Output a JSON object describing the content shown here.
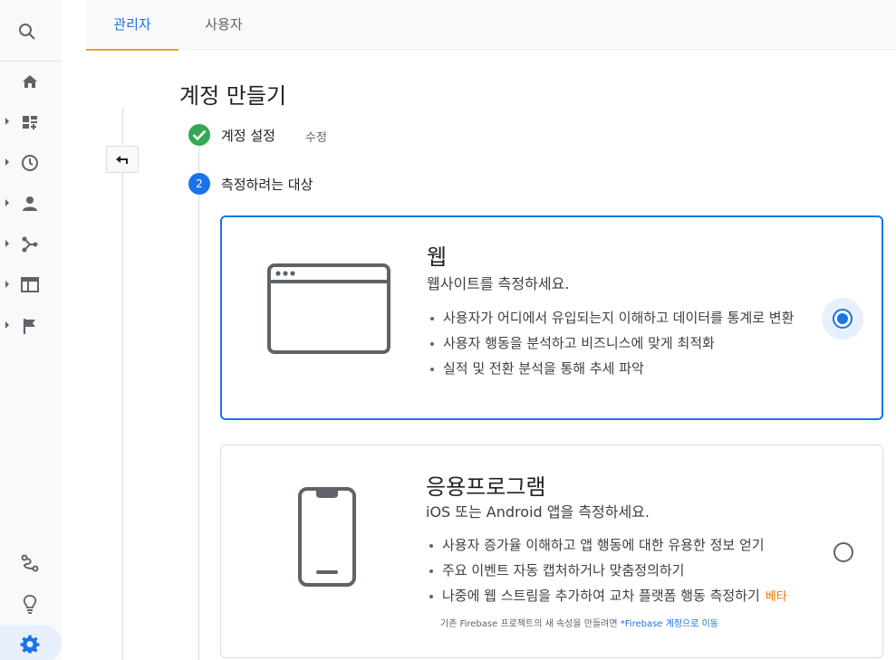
{
  "tabs": {
    "admin": "관리자",
    "user": "사용자"
  },
  "page": {
    "title": "계정 만들기"
  },
  "steps": {
    "step1": {
      "label": "계정 설정",
      "edit": "수정"
    },
    "step2": {
      "number": "2",
      "label": "측정하려는 대상"
    }
  },
  "options": {
    "web": {
      "title": "웹",
      "subtitle": "웹사이트를 측정하세요.",
      "bullets": [
        "사용자가 어디에서 유입되는지 이해하고 데이터를 통계로 변환",
        "사용자 행동을 분석하고 비즈니스에 맞게 최적화",
        "실적 및 전환 분석을 통해 추세 파악"
      ],
      "selected": true
    },
    "app": {
      "title": "응용프로그램",
      "subtitle": "iOS 또는 Android 앱을 측정하세요.",
      "bullets": [
        "사용자 증가율 이해하고 앱 행동에 대한 유용한 정보 얻기",
        "주요 이벤트 자동 캡처하거나 맞춤정의하기",
        "나중에 웹 스트림을 추가하여 교차 플랫폼 행동 측정하기"
      ],
      "beta": "베타",
      "note_text": "기존 Firebase 프로젝트의 새 속성을 만들려면 ",
      "note_link": "*Firebase 계정으로 이동",
      "selected": false
    }
  },
  "rail_icons": [
    "search-icon",
    "home-icon",
    "customization-icon",
    "realtime-icon",
    "audience-icon",
    "acquisition-icon",
    "behavior-icon",
    "conversions-icon",
    "attribution-icon",
    "discover-icon",
    "admin-gear-icon"
  ],
  "colors": {
    "accent": "#1a73e8",
    "success": "#34a853",
    "tab_underline": "#e8a33d",
    "beta": "#e37400"
  }
}
